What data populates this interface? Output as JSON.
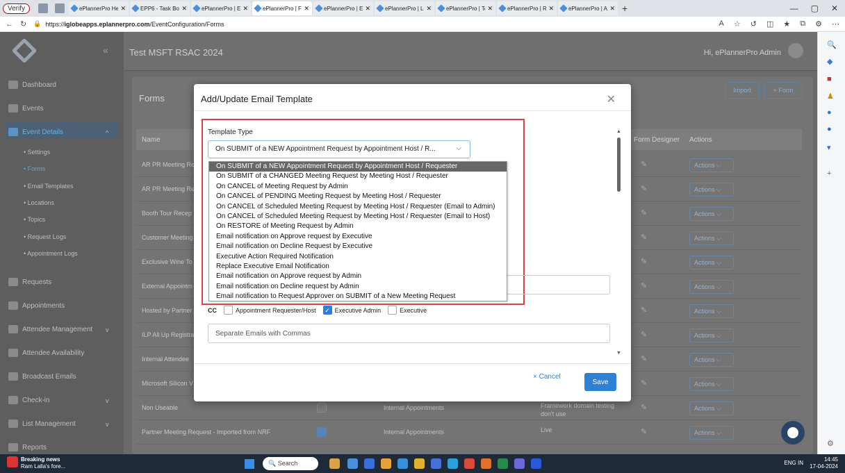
{
  "browser": {
    "verify_label": "Verify",
    "tabs": [
      "ePlannerPro He",
      "EPP6 - Task Boo",
      "ePlannerPro | Ev",
      "ePlannerPro | F",
      "ePlannerPro | Ev",
      "ePlannerPro | Lo",
      "ePlannerPro | To",
      "ePlannerPro | Re",
      "ePlannerPro | A"
    ],
    "active_tab": 3,
    "url_prefix": "https://",
    "url_host": "iglobeapps.eplannerpro.com",
    "url_path": "/EventConfiguration/Forms"
  },
  "app": {
    "event_title": "Test MSFT RSAC 2024",
    "greeting": "Hi, ePlannerPro Admin",
    "sidebar": {
      "items": [
        {
          "label": "Dashboard"
        },
        {
          "label": "Events"
        },
        {
          "label": "Event Details"
        },
        {
          "label": "Requests"
        },
        {
          "label": "Appointments"
        },
        {
          "label": "Attendee Management"
        },
        {
          "label": "Attendee Availability"
        },
        {
          "label": "Broadcast Emails"
        },
        {
          "label": "Check-in"
        },
        {
          "label": "List Management"
        },
        {
          "label": "Reports"
        }
      ],
      "subitems": [
        {
          "label": "Settings"
        },
        {
          "label": "Forms"
        },
        {
          "label": "Email Templates"
        },
        {
          "label": "Locations"
        },
        {
          "label": "Topics"
        },
        {
          "label": "Request Logs"
        },
        {
          "label": "Appointment Logs"
        }
      ]
    },
    "page": {
      "title": "Forms",
      "import_label": "Import",
      "add_form_label": "+ Form",
      "columns": {
        "name": "Name",
        "form_designer": "Form Designer",
        "actions": "Actions"
      },
      "rows": [
        {
          "name": "AR PR Meeting Re",
          "category": "",
          "status": ""
        },
        {
          "name": "AR PR Meeting Re",
          "category": "",
          "status": ""
        },
        {
          "name": "Booth Tour Recep",
          "category": "",
          "status": ""
        },
        {
          "name": "Customer Meeting",
          "category": "",
          "status": ""
        },
        {
          "name": "Exclusive Wine To",
          "category": "",
          "status": ""
        },
        {
          "name": "External Appointm",
          "category": "",
          "status": ""
        },
        {
          "name": "Hosted by Partner",
          "category": "",
          "status": ""
        },
        {
          "name": "ILP All Up Registra",
          "category": "",
          "status": ""
        },
        {
          "name": "Internal Attendee",
          "category": "",
          "status": ""
        },
        {
          "name": "Microsoft Silicon V",
          "category": "",
          "status": ""
        },
        {
          "name": "Non Useable",
          "category": "Internal Appointments",
          "status": "Framework domain testing don't use"
        },
        {
          "name": "Partner Meeting Request - Imported from NRF",
          "category": "Internal Appointments",
          "status": "Live"
        }
      ],
      "row_action_label": "Actions"
    }
  },
  "modal": {
    "title": "Add/Update Email Template",
    "template_type_label": "Template Type",
    "selected_value": "On SUBMIT of a NEW Appointment Request by Appointment Host / R...",
    "options": [
      "On SUBMIT of a NEW Appointment Request by Appointment Host / Requester",
      "On SUBMIT of a CHANGED Meeting Request by Meeting Host / Requester",
      "On CANCEL of Meeting Request by Admin",
      "On CANCEL of PENDING Meeting Request by Meeting Host / Requester",
      "On CANCEL of Scheduled Meeting Request by Meeting Host / Requester (Email to Admin)",
      "On CANCEL of Scheduled Meeting Request by Meeting Host / Requester (Email to Host)",
      "On RESTORE of Meeting Request by Admin",
      "Email notification on Approve request by Executive",
      "Email notification on Decline Request by Executive",
      "Executive Action Required Notification",
      "Replace Executive Email Notification",
      "Email notification on Approve request by Admin",
      "Email notification on Decline request by Admin",
      "Email notification to Request Approver on SUBMIT of a New Meeting Request"
    ],
    "cc_label": "CC",
    "cc_options": [
      {
        "label": "Appointment Requester/Host",
        "checked": false
      },
      {
        "label": "Executive Admin",
        "checked": true
      },
      {
        "label": "Executive",
        "checked": false
      }
    ],
    "emails_placeholder": "Separate Emails with Commas",
    "cancel_label": "× Cancel",
    "save_label": "Save"
  },
  "taskbar": {
    "news_title": "Breaking news",
    "news_sub": "Ram Lalla's fore...",
    "search_placeholder": "Search",
    "lang": "ENG",
    "region": "IN",
    "time": "14:45",
    "date": "17-04-2024"
  }
}
